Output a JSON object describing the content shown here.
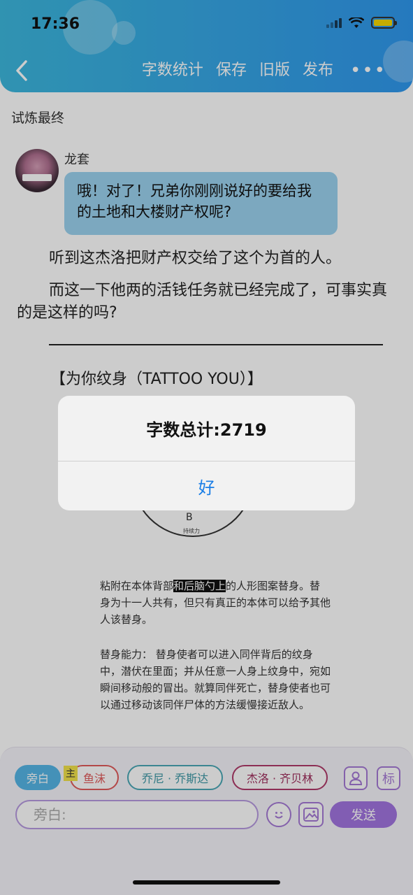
{
  "status_bar": {
    "time": "17:36"
  },
  "header": {
    "back_icon": "chevron-left-icon",
    "actions": [
      "字数统计",
      "保存",
      "旧版",
      "发布"
    ],
    "more_icon": "more-dots-icon"
  },
  "doc_title": "试炼最终",
  "message": {
    "speaker": "龙套",
    "text": "哦！对了！兄弟你刚刚说好的要给我的土地和大楼财产权呢?"
  },
  "paragraphs": [
    "听到这杰洛把财产权交给了这个为首的人。",
    "而这一下他两的活钱任务就已经完成了，可事实真的是这样的吗?"
  ],
  "section_title": "【为你纹身（TATTOO YOU）】",
  "diagram": {
    "letter": "B",
    "sublabel": "持续力"
  },
  "description": {
    "p1_before": "粘附在本体背部",
    "p1_highlight": "和后脑勺上",
    "p1_after": "的人形图案替身。替身为十一人共有，但只有真正的本体可以给予其他人该替身。",
    "p2": "替身能力： 替身使者可以进入同伴背后的纹身中，潜伏在里面；并从任意一人身上纹身中，宛如瞬间移动般的冒出。就算同伴死亡，替身使者也可以通过移动该同伴尸体的方法缓慢接近敌人。"
  },
  "characters": {
    "narration": "旁白",
    "badge": "主",
    "c1": "鱼沫",
    "c2": "乔尼 · 乔斯达",
    "c3": "杰洛 · 齐贝林"
  },
  "side_buttons": {
    "person_icon": "person-icon",
    "mark_label": "标"
  },
  "input": {
    "placeholder": "旁白:"
  },
  "emoji_icon": "smiley-icon",
  "image_icon": "image-icon",
  "send_label": "发送",
  "dialog": {
    "message": "字数总计:2719",
    "ok_label": "好",
    "link_color": "#1a7ee6"
  },
  "colors": {
    "header": "#36a6e6",
    "bubble": "#9cd3ef",
    "accent": "#a275e0"
  }
}
